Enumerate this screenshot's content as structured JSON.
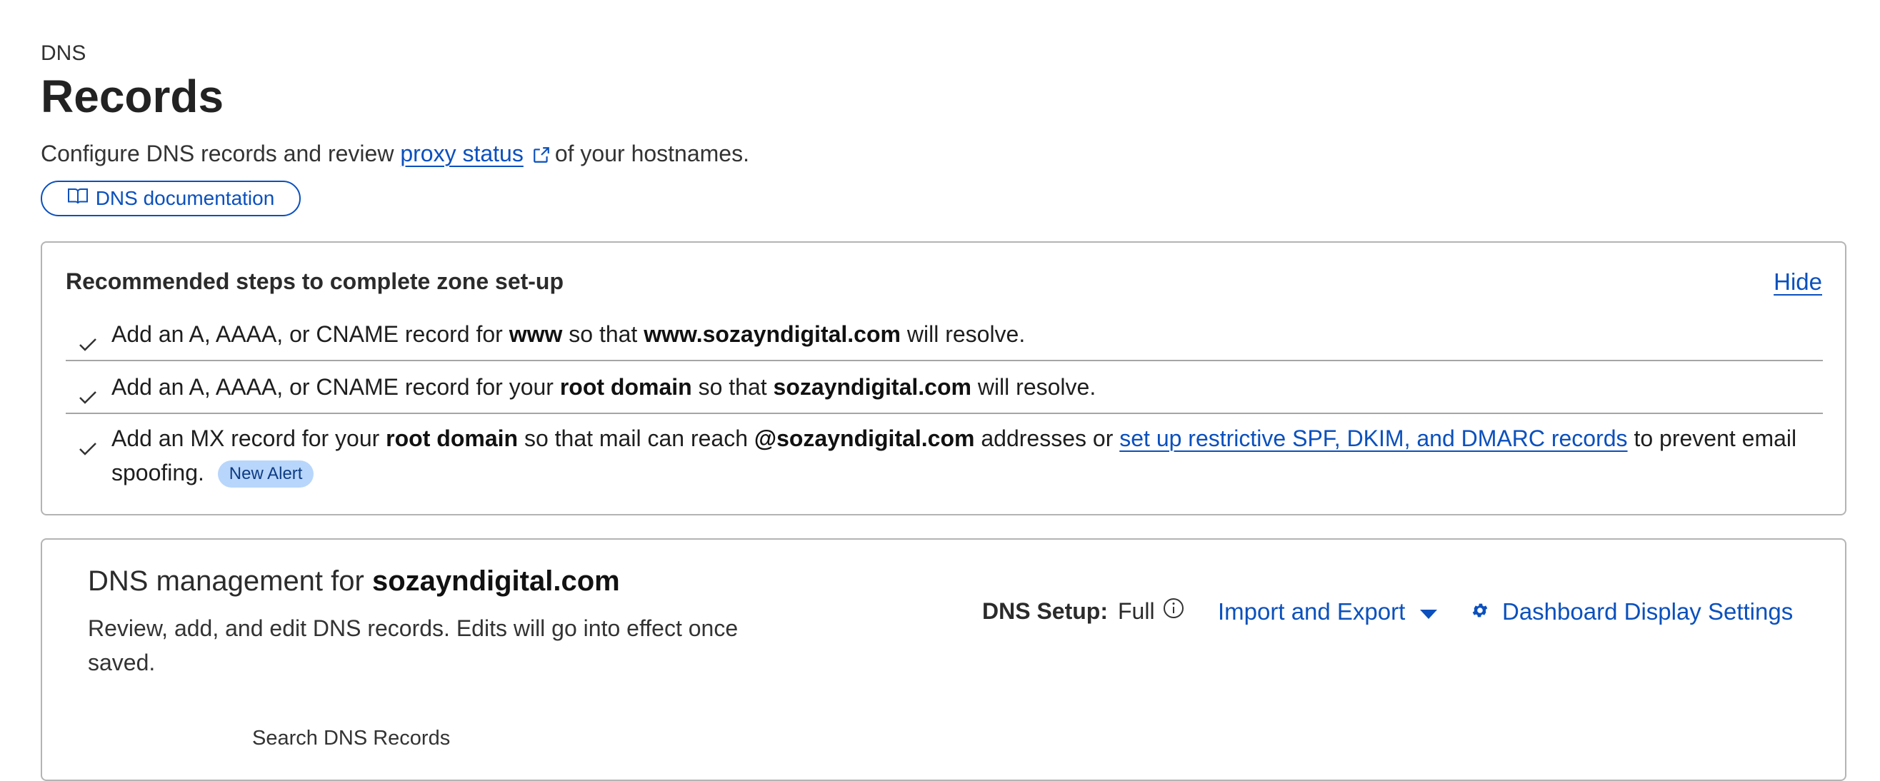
{
  "header": {
    "breadcrumb": "DNS",
    "title": "Records",
    "subtitle_pre": "Configure DNS records and review",
    "subtitle_link": "proxy status",
    "subtitle_post": "of your hostnames.",
    "doc_button": "DNS documentation"
  },
  "recommended": {
    "title": "Recommended steps to complete zone set-up",
    "hide_label": "Hide",
    "step1": {
      "t1": "Add an A, AAAA, or CNAME record for",
      "b1": "www",
      "t2": "so that",
      "b2": "www.sozayndigital.com",
      "t3": "will resolve."
    },
    "step2": {
      "t1": "Add an A, AAAA, or CNAME record for your",
      "b1": "root domain",
      "t2": "so that",
      "b2": "sozayndigital.com",
      "t3": "will resolve."
    },
    "step3": {
      "t1": "Add an MX record for your",
      "b1": "root domain",
      "t2": "so that mail can reach",
      "b2": "@sozayndigital.com",
      "t3": "addresses or",
      "link": "set up restrictive SPF, DKIM, and DMARC records",
      "t4": "to prevent email spoofing.",
      "badge": "New Alert"
    }
  },
  "management": {
    "title_pre": "DNS management for",
    "domain": "sozayndigital.com",
    "description": "Review, add, and edit DNS records. Edits will go into effect once saved.",
    "setup_label": "DNS Setup:",
    "setup_value": "Full",
    "import_export": "Import and Export",
    "dashboard_settings": "Dashboard Display Settings",
    "search_label": "Search DNS Records"
  },
  "colors": {
    "link": "#0b50bd",
    "badge_bg": "#b8d6fb",
    "border": "#b4b4b4"
  },
  "icons": [
    "external-link-icon",
    "book-icon",
    "check-icon",
    "info-icon",
    "caret-down-icon",
    "gear-icon"
  ]
}
